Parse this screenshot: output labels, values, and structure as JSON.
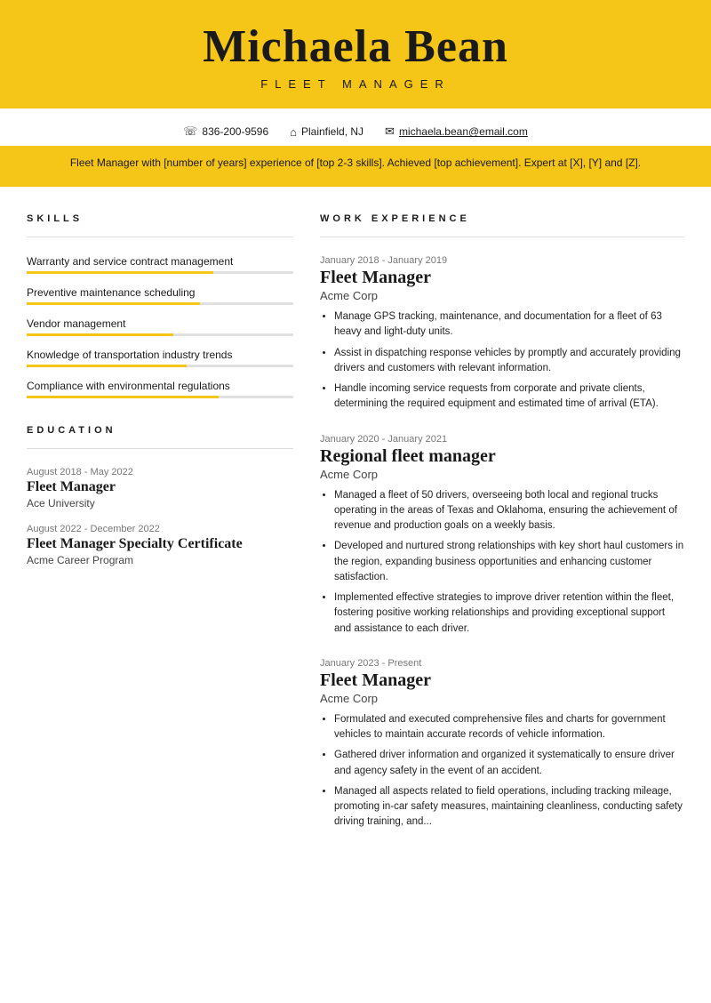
{
  "header": {
    "name": "Michaela Bean",
    "title": "Fleet Manager",
    "phone": "836-200-9596",
    "location": "Plainfield, NJ",
    "email": "michaela.bean@email.com",
    "summary": "Fleet Manager with [number of years] experience of [top 2-3 skills]. Achieved [top achievement]. Expert at [X], [Y] and [Z]."
  },
  "skills": {
    "section_title": "SKILLS",
    "items": [
      {
        "name": "Warranty and service contract management",
        "pct": 70
      },
      {
        "name": "Preventive maintenance scheduling",
        "pct": 65
      },
      {
        "name": "Vendor management",
        "pct": 55
      },
      {
        "name": "Knowledge of transportation industry trends",
        "pct": 60
      },
      {
        "name": "Compliance with environmental regulations",
        "pct": 72
      }
    ]
  },
  "education": {
    "section_title": "EDUCATION",
    "items": [
      {
        "date": "August 2018 - May 2022",
        "degree": "Fleet Manager",
        "school": "Ace University"
      },
      {
        "date": "August 2022 - December 2022",
        "degree": "Fleet Manager Specialty Certificate",
        "school": "Acme Career Program"
      }
    ]
  },
  "work": {
    "section_title": "WORK EXPERIENCE",
    "entries": [
      {
        "date": "January 2018 - January 2019",
        "title": "Fleet Manager",
        "company": "Acme Corp",
        "bullets": [
          "Manage GPS tracking, maintenance, and documentation for a fleet of 63 heavy and light-duty units.",
          "Assist in dispatching response vehicles by promptly and accurately providing drivers and customers with relevant information.",
          "Handle incoming service requests from corporate and private clients, determining the required equipment and estimated time of arrival (ETA)."
        ]
      },
      {
        "date": "January 2020 - January 2021",
        "title": "Regional fleet manager",
        "company": "Acme Corp",
        "bullets": [
          "Managed a fleet of 50 drivers, overseeing both local and regional trucks operating in the areas of Texas and Oklahoma, ensuring the achievement of revenue and production goals on a weekly basis.",
          "Developed and nurtured strong relationships with key short haul customers in the region, expanding business opportunities and enhancing customer satisfaction.",
          "Implemented effective strategies to improve driver retention within the fleet, fostering positive working relationships and providing exceptional support and assistance to each driver."
        ]
      },
      {
        "date": "January 2023 - Present",
        "title": "Fleet Manager",
        "company": "Acme Corp",
        "bullets": [
          "Formulated and executed comprehensive files and charts for government vehicles to maintain accurate records of vehicle information.",
          "Gathered driver information and organized it systematically to ensure driver and agency safety in the event of an accident.",
          "Managed all aspects related to field operations, including tracking mileage, promoting in-car safety measures, maintaining cleanliness, conducting safety driving training, and..."
        ]
      }
    ]
  }
}
